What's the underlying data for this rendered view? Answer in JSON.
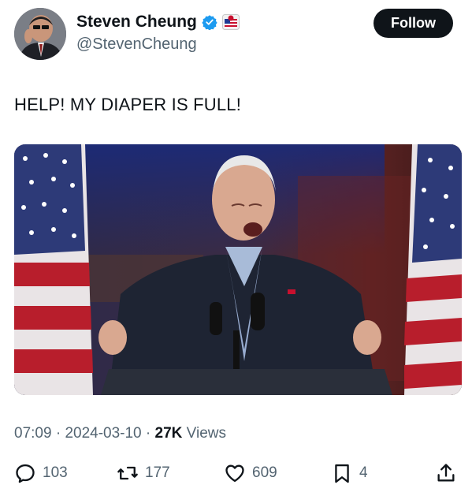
{
  "author": {
    "name": "Steven Cheung",
    "handle": "@StevenCheung"
  },
  "follow_label": "Follow",
  "tweet": {
    "text": "HELP! MY DIAPER IS FULL!"
  },
  "meta": {
    "time": "07:09",
    "sep1": " · ",
    "date": "2024-03-10",
    "sep2": " · ",
    "views_count": "27K",
    "views_label": " Views"
  },
  "actions": {
    "replies": "103",
    "reposts": "177",
    "likes": "609",
    "bookmarks": "4"
  },
  "colors": {
    "accent": "#1d9bf0",
    "text": "#0f1419",
    "secondary": "#536471"
  },
  "icons": [
    "verified-badge-icon",
    "flag-badge-icon",
    "reply-icon",
    "repost-icon",
    "like-icon",
    "bookmark-icon",
    "share-icon"
  ]
}
